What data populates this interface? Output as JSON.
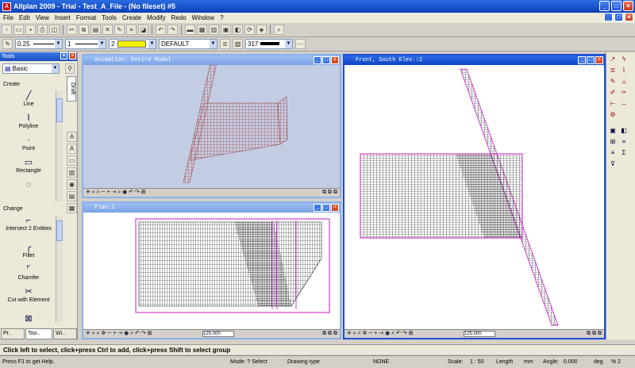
{
  "title": "Allplan 2009 - Trial - Test_A_File - (No fileset) #5",
  "window_buttons": [
    "_",
    "□",
    "×"
  ],
  "menu": [
    "File",
    "Edit",
    "View",
    "Insert",
    "Format",
    "Tools",
    "Create",
    "Modify",
    "Redo",
    "Window",
    "?"
  ],
  "toolbar2": {
    "pen": "0.25",
    "line": "1",
    "color": "2",
    "layer": "DEFAULT",
    "pattern": "317"
  },
  "palette": {
    "header": "Tools",
    "module": "Basic",
    "vtab": "Draft",
    "section_create": "Create",
    "create_items": [
      "Line",
      "Polyline",
      "Point",
      "Rectangle"
    ],
    "section_change": "Change",
    "change_items": [
      "Intersect 2 Entities",
      "Fillet",
      "Chamfer",
      "Cut with Element"
    ],
    "tabs": [
      "Pr..",
      "Too..",
      "Wi.."
    ]
  },
  "windows": {
    "animation": {
      "title": "Animation: Entire Model",
      "scale": ""
    },
    "plan": {
      "title": "Plan:1",
      "scale": "125.000"
    },
    "front": {
      "title": "Front, South Elev.:2",
      "scale": "125.000"
    }
  },
  "hint": "Click left to select, click+press Ctrl to add, click+press Shift to select group",
  "status": {
    "help": "Press F1 to get Help.",
    "mode": "Mode: ? Select",
    "drawing": "Drawing type",
    "none": "NONE",
    "scale_label": "Scale:",
    "scale": "1 : 50",
    "length_label": "Length",
    "length": "mm",
    "angle_label": "Angle:",
    "angle": "0.000",
    "deg": "deg",
    "pct": "% 2"
  },
  "colors": {
    "titlebar": "#0a3fb8",
    "mesh_anim": "#b05050",
    "mesh": "#1a1a1a",
    "outline": "#d040d0",
    "anim_bg": "#c2cde4"
  }
}
